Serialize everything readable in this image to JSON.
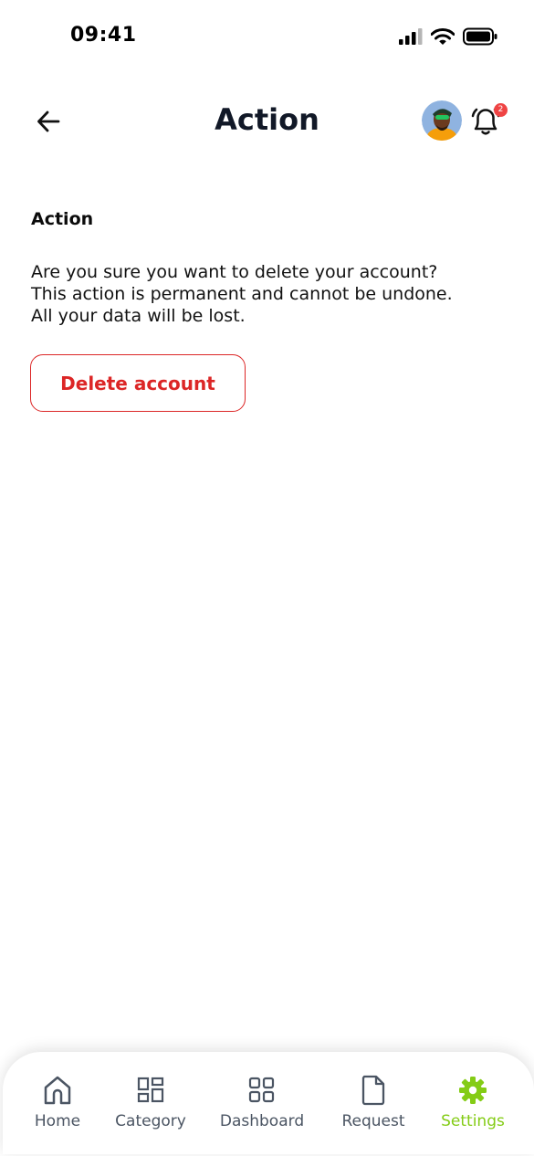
{
  "status_bar": {
    "time": "09:41"
  },
  "header": {
    "title": "Action",
    "notification_count": "2"
  },
  "content": {
    "section_title": "Action",
    "message_lines": [
      "Are you sure you want to delete your account?",
      "This action is permanent and cannot be undone.",
      "All your data will be lost."
    ],
    "delete_button_label": "Delete account"
  },
  "bottom_nav": {
    "items": [
      {
        "label": "Home",
        "icon": "home-icon"
      },
      {
        "label": "Category",
        "icon": "category-icon"
      },
      {
        "label": "Dashboard",
        "icon": "dashboard-icon"
      },
      {
        "label": "Request",
        "icon": "document-icon"
      },
      {
        "label": "Settings",
        "icon": "gear-icon",
        "active": true
      }
    ]
  },
  "colors": {
    "danger": "#dc2626",
    "accent": "#84cc16",
    "badge": "#ef4444",
    "text": "#111827"
  }
}
